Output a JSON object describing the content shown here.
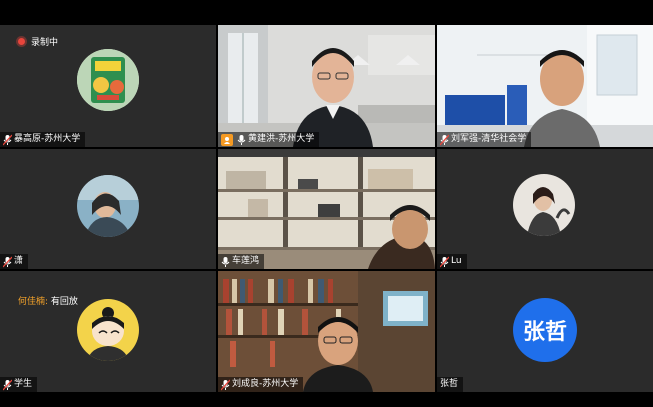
{
  "recording": {
    "label": "录制中"
  },
  "participants": [
    {
      "name": "暴高原-苏州大学"
    },
    {
      "name": "黄建洪-苏州大学"
    },
    {
      "name": "刘军强-清华社会学"
    },
    {
      "name": "潇"
    },
    {
      "name": "车莲鸿"
    },
    {
      "name": "Lu"
    },
    {
      "name": "学生"
    },
    {
      "name": "刘成良-苏州大学"
    },
    {
      "name": "张哲"
    }
  ],
  "chat": {
    "sender": "何佳楠:",
    "message": "有回放"
  },
  "text_avatar": {
    "label": "张哲",
    "color": "#1f6feb"
  },
  "colors": {
    "active_border": "#3ad36a",
    "record_dot": "#e8453c",
    "tile_bg": "#2b2b2b"
  }
}
